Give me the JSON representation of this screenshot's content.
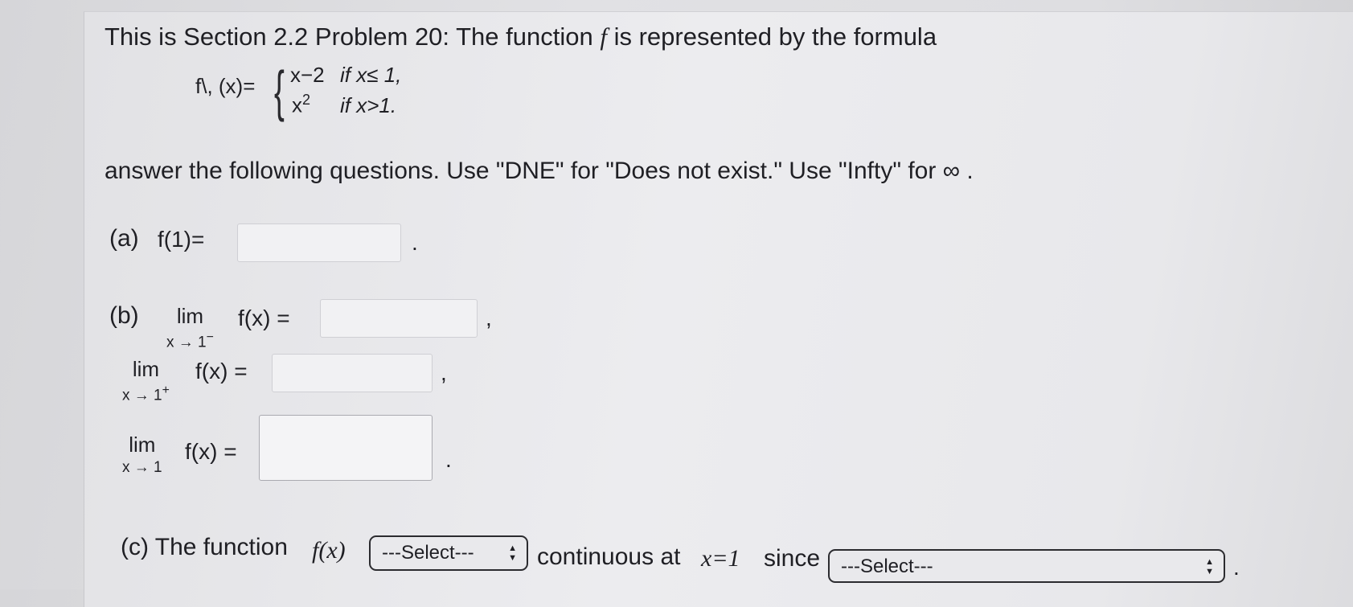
{
  "problem": {
    "intro": "This is Section 2.2 Problem 20: The function",
    "fname": "f",
    "intro_end": "is represented by the formula",
    "formula_head": "f\\, (x)=",
    "piece1_expr": "x−2",
    "piece1_cond": "if x≤ 1,",
    "piece2_expr": "x",
    "piece2_exp": "2",
    "piece2_cond": "if x>1.",
    "instructions": "answer the following questions. Use \"DNE\" for \"Does not exist.\" Use \"Infty\" for ∞ ."
  },
  "part_a": {
    "label": "(a)",
    "expr": "f(1)=",
    "answer_value": "",
    "end": "."
  },
  "part_b": {
    "label": "(b)",
    "lim_left": {
      "lim": "lim",
      "sub": "x → 1",
      "sup": "−",
      "expr": "f(x) =",
      "answer_value": "",
      "end": ","
    },
    "lim_right": {
      "lim": "lim",
      "sub": "x → 1",
      "sup": "+",
      "expr": "f(x) =",
      "answer_value": "",
      "end": ","
    },
    "lim_both": {
      "lim": "lim",
      "sub": "x → 1",
      "expr": "f(x) =",
      "answer_value": "",
      "end": "."
    }
  },
  "part_c": {
    "label": "(c) The function",
    "fx": "f(x)",
    "select1_value": "---Select---",
    "middle": "continuous at",
    "x_eq": "x=1",
    "since": "since",
    "select2_value": "---Select---",
    "end": "."
  }
}
